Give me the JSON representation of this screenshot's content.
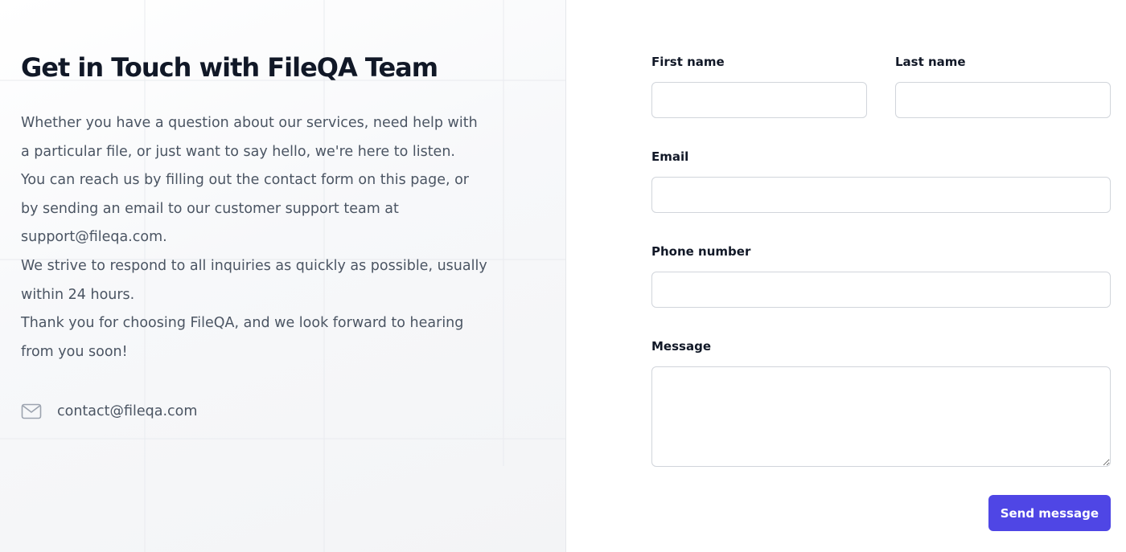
{
  "header": {
    "title": "Get in Touch with FileQA Team"
  },
  "intro": {
    "paragraphs": [
      "Whether you have a question about our services, need help with a particular file, or just want to say hello, we're here to listen.",
      "You can reach us by filling out the contact form on this page, or by sending an email to our customer support team at support@fileqa.com.",
      "We strive to respond to all inquiries as quickly as possible, usually within 24 hours.",
      "Thank you for choosing FileQA, and we look forward to hearing from you soon!"
    ]
  },
  "contact": {
    "icon": "mail-icon",
    "email": "contact@fileqa.com"
  },
  "form": {
    "first_name": {
      "label": "First name",
      "value": "",
      "placeholder": ""
    },
    "last_name": {
      "label": "Last name",
      "value": "",
      "placeholder": ""
    },
    "email": {
      "label": "Email",
      "value": "",
      "placeholder": ""
    },
    "phone": {
      "label": "Phone number",
      "value": "",
      "placeholder": ""
    },
    "message": {
      "label": "Message",
      "value": "",
      "placeholder": ""
    },
    "submit_label": "Send message"
  },
  "colors": {
    "accent": "#4f46e5",
    "heading": "#111827",
    "body_text": "#4b5563",
    "input_border": "#d1d5db"
  }
}
